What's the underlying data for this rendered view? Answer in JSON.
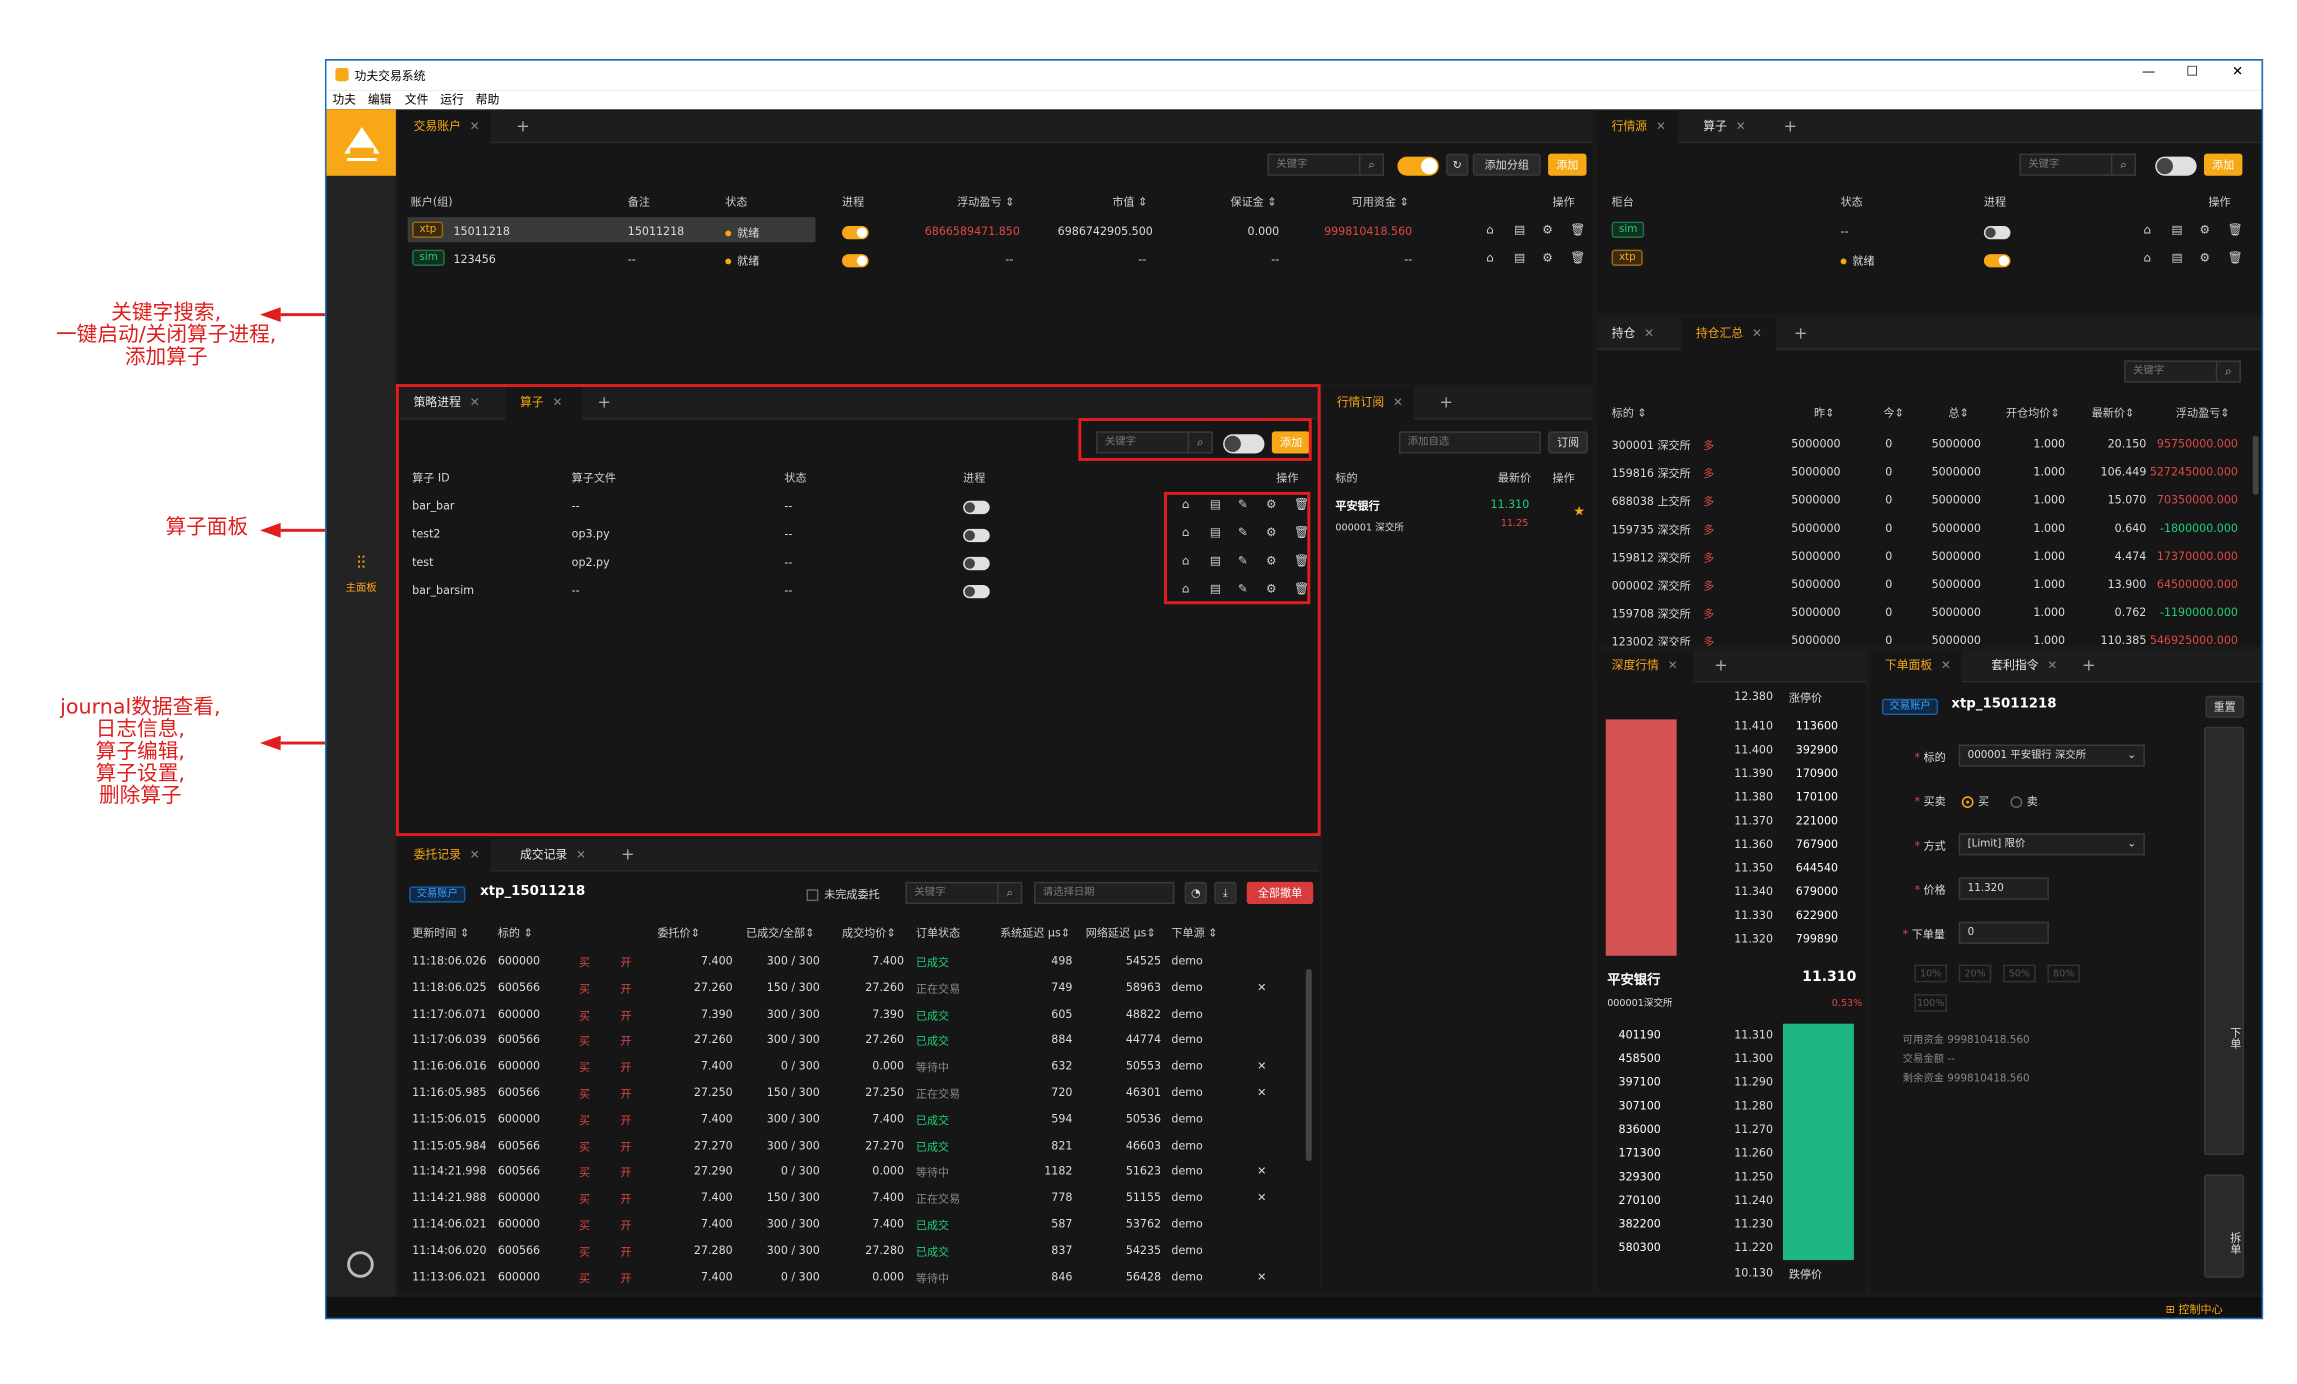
{
  "window": {
    "title": "功夫交易系统",
    "min": "—",
    "max": "☐",
    "close": "✕"
  },
  "menu": [
    "功夫",
    "编辑",
    "文件",
    "运行",
    "帮助"
  ],
  "sidebar": {
    "main_label": "主面板"
  },
  "status": {
    "control_center": "控制中心"
  },
  "common": {
    "keyword": "关键字",
    "add": "添加",
    "close_x": "✕",
    "plus": "+",
    "dash": "--"
  },
  "accounts": {
    "tabs": [
      "交易账户"
    ],
    "add_group": "添加分组",
    "headers": [
      "账户(组)",
      "备注",
      "状态",
      "进程",
      "浮动盈亏 ⇕",
      "市值 ⇕",
      "保证金 ⇕",
      "可用资金 ⇕",
      "操作"
    ],
    "rows": [
      {
        "tag": "xtp",
        "id": "15011218",
        "note": "15011218",
        "state": "就绪",
        "pnl": "6866589471.850",
        "mv": "6986742905.500",
        "margin": "0.000",
        "avail": "999810418.560"
      },
      {
        "tag": "sim",
        "id": "123456",
        "note": "--",
        "state": "就绪",
        "pnl": "--",
        "mv": "--",
        "margin": "--",
        "avail": "--"
      }
    ]
  },
  "sources": {
    "tabs": [
      "行情源",
      "算子"
    ],
    "headers": [
      "柜台",
      "状态",
      "进程",
      "操作"
    ],
    "rows": [
      {
        "tag": "sim",
        "state": "--"
      },
      {
        "tag": "xtp",
        "state": "就绪"
      }
    ]
  },
  "strategy": {
    "tabs": [
      "策略进程",
      "算子"
    ],
    "headers": [
      "算子 ID",
      "算子文件",
      "状态",
      "进程",
      "操作"
    ],
    "rows": [
      {
        "id": "bar_bar",
        "file": "--",
        "state": "--"
      },
      {
        "id": "test2",
        "file": "op3.py",
        "state": "--"
      },
      {
        "id": "test",
        "file": "op2.py",
        "state": "--"
      },
      {
        "id": "bar_barsim",
        "file": "--",
        "state": "--"
      }
    ]
  },
  "market_sub": {
    "tabs": [
      "行情订阅"
    ],
    "add_watch": "添加自选",
    "subscribe": "订阅",
    "headers": [
      "标的",
      "最新价",
      "操作"
    ],
    "item": {
      "name": "平安银行",
      "code": "000001 深交所",
      "price": "11.310",
      "change": "11.25"
    }
  },
  "positions": {
    "tabs": [
      "持仓",
      "持仓汇总"
    ],
    "headers": [
      "标的 ⇕",
      "昨⇕",
      "今⇕",
      "总⇕",
      "开仓均价⇕",
      "最新价⇕",
      "浮动盈亏⇕"
    ],
    "rows": [
      {
        "code": "300001 深交所",
        "dir": "多",
        "y": "5000000",
        "t": "0",
        "total": "5000000",
        "avg": "1.000",
        "last": "20.150",
        "pnl": "95750000.000",
        "up": true
      },
      {
        "code": "159816 深交所",
        "dir": "多",
        "y": "5000000",
        "t": "0",
        "total": "5000000",
        "avg": "1.000",
        "last": "106.449",
        "pnl": "527245000.000",
        "up": true
      },
      {
        "code": "688038 上交所",
        "dir": "多",
        "y": "5000000",
        "t": "0",
        "total": "5000000",
        "avg": "1.000",
        "last": "15.070",
        "pnl": "70350000.000",
        "up": true
      },
      {
        "code": "159735 深交所",
        "dir": "多",
        "y": "5000000",
        "t": "0",
        "total": "5000000",
        "avg": "1.000",
        "last": "0.640",
        "pnl": "-1800000.000",
        "up": false
      },
      {
        "code": "159812 深交所",
        "dir": "多",
        "y": "5000000",
        "t": "0",
        "total": "5000000",
        "avg": "1.000",
        "last": "4.474",
        "pnl": "17370000.000",
        "up": true
      },
      {
        "code": "000002 深交所",
        "dir": "多",
        "y": "5000000",
        "t": "0",
        "total": "5000000",
        "avg": "1.000",
        "last": "13.900",
        "pnl": "64500000.000",
        "up": true
      },
      {
        "code": "159708 深交所",
        "dir": "多",
        "y": "5000000",
        "t": "0",
        "total": "5000000",
        "avg": "1.000",
        "last": "0.762",
        "pnl": "-1190000.000",
        "up": false
      },
      {
        "code": "123002 深交所",
        "dir": "多",
        "y": "5000000",
        "t": "0",
        "total": "5000000",
        "avg": "1.000",
        "last": "110.385",
        "pnl": "546925000.000",
        "up": true
      }
    ]
  },
  "orders": {
    "tabs": [
      "委托记录",
      "成交记录"
    ],
    "account_tag": "交易账户",
    "account": "xtp_15011218",
    "unfinished": "未完成委托",
    "date_ph": "请选择日期",
    "cancel_all": "全部撤单",
    "headers": [
      "更新时间 ⇕",
      "标的 ⇕",
      "",
      "",
      "委托价⇕",
      "已成交/全部⇕",
      "成交均价⇕",
      "订单状态",
      "系统延迟 μs⇕",
      "网络延迟 μs⇕",
      "下单源 ⇕"
    ],
    "rows": [
      {
        "time": "11:18:06.026",
        "code": "600000",
        "side": "买",
        "off": "开",
        "price": "7.400",
        "fill": "300 / 300",
        "avg": "7.400",
        "st": "已成交",
        "sys": "498",
        "net": "54525",
        "src": "demo",
        "x": false
      },
      {
        "time": "11:18:06.025",
        "code": "600566",
        "side": "买",
        "off": "开",
        "price": "27.260",
        "fill": "150 / 300",
        "avg": "27.260",
        "st": "正在交易",
        "sys": "749",
        "net": "58963",
        "src": "demo",
        "x": true
      },
      {
        "time": "11:17:06.071",
        "code": "600000",
        "side": "买",
        "off": "开",
        "price": "7.390",
        "fill": "300 / 300",
        "avg": "7.390",
        "st": "已成交",
        "sys": "605",
        "net": "48822",
        "src": "demo",
        "x": false
      },
      {
        "time": "11:17:06.039",
        "code": "600566",
        "side": "买",
        "off": "开",
        "price": "27.260",
        "fill": "300 / 300",
        "avg": "27.260",
        "st": "已成交",
        "sys": "884",
        "net": "44774",
        "src": "demo",
        "x": false
      },
      {
        "time": "11:16:06.016",
        "code": "600000",
        "side": "买",
        "off": "开",
        "price": "7.400",
        "fill": "0 / 300",
        "avg": "0.000",
        "st": "等待中",
        "sys": "632",
        "net": "50553",
        "src": "demo",
        "x": true
      },
      {
        "time": "11:16:05.985",
        "code": "600566",
        "side": "买",
        "off": "开",
        "price": "27.250",
        "fill": "150 / 300",
        "avg": "27.250",
        "st": "正在交易",
        "sys": "720",
        "net": "46301",
        "src": "demo",
        "x": true
      },
      {
        "time": "11:15:06.015",
        "code": "600000",
        "side": "买",
        "off": "开",
        "price": "7.400",
        "fill": "300 / 300",
        "avg": "7.400",
        "st": "已成交",
        "sys": "594",
        "net": "50536",
        "src": "demo",
        "x": false
      },
      {
        "time": "11:15:05.984",
        "code": "600566",
        "side": "买",
        "off": "开",
        "price": "27.270",
        "fill": "300 / 300",
        "avg": "27.270",
        "st": "已成交",
        "sys": "821",
        "net": "46603",
        "src": "demo",
        "x": false
      },
      {
        "time": "11:14:21.998",
        "code": "600566",
        "side": "买",
        "off": "开",
        "price": "27.290",
        "fill": "0 / 300",
        "avg": "0.000",
        "st": "等待中",
        "sys": "1182",
        "net": "51623",
        "src": "demo",
        "x": true
      },
      {
        "time": "11:14:21.988",
        "code": "600000",
        "side": "买",
        "off": "开",
        "price": "7.400",
        "fill": "150 / 300",
        "avg": "7.400",
        "st": "正在交易",
        "sys": "778",
        "net": "51155",
        "src": "demo",
        "x": true
      },
      {
        "time": "11:14:06.021",
        "code": "600000",
        "side": "买",
        "off": "开",
        "price": "7.400",
        "fill": "300 / 300",
        "avg": "7.400",
        "st": "已成交",
        "sys": "587",
        "net": "53762",
        "src": "demo",
        "x": false
      },
      {
        "time": "11:14:06.020",
        "code": "600566",
        "side": "买",
        "off": "开",
        "price": "27.280",
        "fill": "300 / 300",
        "avg": "27.280",
        "st": "已成交",
        "sys": "837",
        "net": "54235",
        "src": "demo",
        "x": false
      },
      {
        "time": "11:13:06.021",
        "code": "600000",
        "side": "买",
        "off": "开",
        "price": "7.400",
        "fill": "0 / 300",
        "avg": "0.000",
        "st": "等待中",
        "sys": "846",
        "net": "56428",
        "src": "demo",
        "x": true
      }
    ]
  },
  "depth": {
    "tabs": [
      "深度行情"
    ],
    "upper_limit_price": "12.380",
    "upper_label": "涨停价",
    "asks": [
      {
        "p": "11.410",
        "v": "113600"
      },
      {
        "p": "11.400",
        "v": "392900"
      },
      {
        "p": "11.390",
        "v": "170900"
      },
      {
        "p": "11.380",
        "v": "170100"
      },
      {
        "p": "11.370",
        "v": "221000"
      },
      {
        "p": "11.360",
        "v": "767900"
      },
      {
        "p": "11.350",
        "v": "644540"
      },
      {
        "p": "11.340",
        "v": "679000"
      },
      {
        "p": "11.330",
        "v": "622900"
      },
      {
        "p": "11.320",
        "v": "799890"
      }
    ],
    "name": "平安银行",
    "code": "000001深交所",
    "last": "11.310",
    "chg": "0.53%",
    "bids": [
      {
        "p": "11.310",
        "v": "401190"
      },
      {
        "p": "11.300",
        "v": "458500"
      },
      {
        "p": "11.290",
        "v": "397100"
      },
      {
        "p": "11.280",
        "v": "307100"
      },
      {
        "p": "11.270",
        "v": "836000"
      },
      {
        "p": "11.260",
        "v": "171300"
      },
      {
        "p": "11.250",
        "v": "329300"
      },
      {
        "p": "11.240",
        "v": "270100"
      },
      {
        "p": "11.230",
        "v": "382200"
      },
      {
        "p": "11.220",
        "v": "580300"
      }
    ],
    "lower_limit_price": "10.130",
    "lower_label": "跌停价"
  },
  "order_panel": {
    "tabs": [
      "下单面板",
      "套利指令"
    ],
    "account_tag": "交易账户",
    "account": "xtp_15011218",
    "reset": "重置",
    "symbol_label": "标的",
    "symbol": "000001 平安银行 深交所",
    "side_label": "买卖",
    "buy": "买",
    "sell": "卖",
    "mode_label": "方式",
    "mode": "[Limit] 限价",
    "price_label": "价格",
    "price": "11.320",
    "qty_label": "下单量",
    "qty": "0",
    "pcts": [
      "10%",
      "20%",
      "50%",
      "80%",
      "100%"
    ],
    "avail_label": "可用资金",
    "avail": "999810418.560",
    "amount_label": "交易金额",
    "amount": "--",
    "remain_label": "剩余资金",
    "remain": "999810418.560",
    "place_btn": "下单",
    "split_btn": "拆单"
  },
  "annotations": {
    "a1": "关键字搜索,\n一键启动/关闭算子进程,\n添加算子",
    "a2": "算子面板",
    "a3": "journal数据查看,\n日志信息,\n算子编辑,\n算子设置,\n删除算子"
  }
}
